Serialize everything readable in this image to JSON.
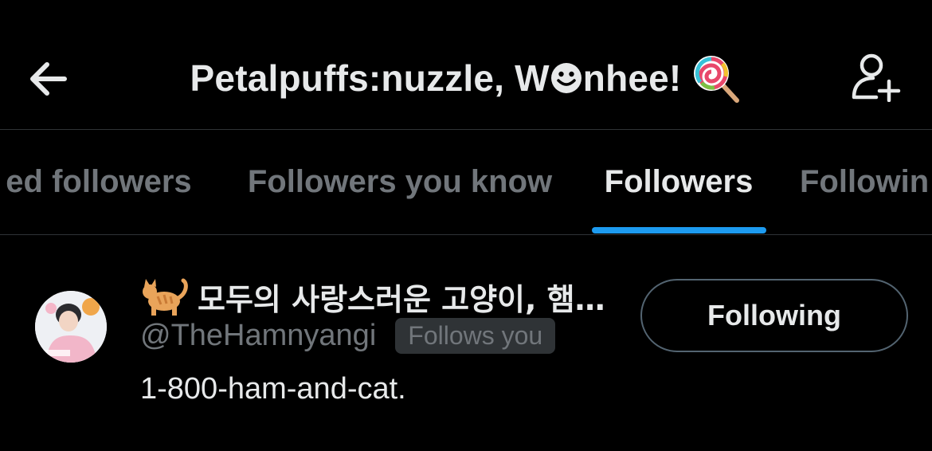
{
  "header": {
    "title": "Petalpuffs:nuzzle, W",
    "title_tail": "nhee!",
    "title_smile_icon": "smiling-face-icon",
    "title_emoji_icon": "lollipop-icon",
    "back_icon": "arrow-left-icon",
    "add_user_icon": "add-user-icon"
  },
  "tabs": [
    {
      "label": "ed followers",
      "active": false
    },
    {
      "label": "Followers you know",
      "active": false
    },
    {
      "label": "Followers",
      "active": true
    },
    {
      "label": "Followin",
      "active": false
    }
  ],
  "user": {
    "emoji_icon": "cat-icon",
    "display_name": "모두의 사랑스러운 고양이, 햄…",
    "handle": "@TheHamnyangi",
    "follows_you_badge": "Follows you",
    "bio": "1-800-ham-and-cat.",
    "follow_button_label": "Following"
  },
  "colors": {
    "background": "#000000",
    "text_primary": "#e7e9ea",
    "text_secondary": "#71767b",
    "divider": "#2f3336",
    "accent": "#1d9bf0",
    "button_border": "#536471"
  }
}
